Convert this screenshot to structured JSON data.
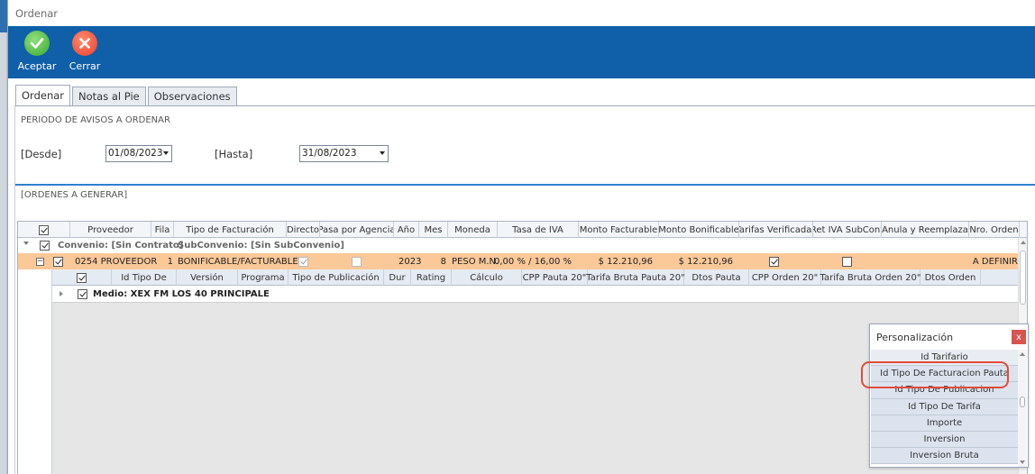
{
  "window": {
    "title": "Ordenar"
  },
  "toolbar": {
    "accept_label": "Aceptar",
    "close_label": "Cerrar"
  },
  "tabs": [
    "Ordenar",
    "Notas al Pie",
    "Observaciones"
  ],
  "periodo": {
    "section_title": "PERIODO DE AVISOS A ORDENAR",
    "desde_label": "[Desde]",
    "desde_value": "01/08/2023",
    "hasta_label": "[Hasta]",
    "hasta_value": "31/08/2023"
  },
  "ordenes": {
    "section_title": "[ORDENES A GENERAR]"
  },
  "grid": {
    "columns": [
      "Proveedor",
      "Fila",
      "Tipo de Facturación",
      "Directo",
      "Pasa por Agencia",
      "Año",
      "Mes",
      "Moneda",
      "Tasa de IVA",
      "Monto Facturable",
      "Monto Bonificable",
      "Tarifas Verificadas",
      "Ret IVA SubCont",
      "Anula y Reemplaza",
      "Nro. Orden"
    ],
    "group_row": {
      "convenio": "Convenio: [Sin Contrato]",
      "subconvenio": "SubConvenio: [Sin SubConvenio]"
    },
    "row": {
      "proveedor": "0254 PROVEEDOR",
      "fila": "1",
      "tipo_facturacion": "BONIFICABLE/FACTURABLE",
      "anio": "2023",
      "mes": "8",
      "moneda": "PESO M.N.",
      "tasa_iva": "0,00 % / 16,00 %",
      "monto_facturable": "$ 12.210,96",
      "monto_bonificable": "$ 12.210,96",
      "nro_orden": "A DEFINIR"
    },
    "sub_columns": [
      "Id Tipo De",
      "Versión",
      "Programa",
      "Tipo de Publicación",
      "Dur",
      "Rating",
      "Cálculo",
      "CPP Pauta 20\"",
      "Tarifa Bruta Pauta 20\"",
      "Dtos Pauta",
      "CPP Orden 20\"",
      "Tarifa Bruta Orden 20\"",
      "Dtos Orden"
    ],
    "medio_row": "Medio: XEX FM LOS 40 PRINCIPALE"
  },
  "personalizacion": {
    "title": "Personalización",
    "close_label": "x",
    "items": [
      "Id Tarifario",
      "Id Tipo De Facturacion Pauta",
      "Id Tipo De Publicacion",
      "Id Tipo De Tarifa",
      "Importe",
      "Inversion",
      "Inversion Bruta"
    ]
  },
  "colors": {
    "toolbar": "#0f5fa9",
    "row_highlight": "#fbc898",
    "accent_rule": "#2f7fcf",
    "callout": "#e14b3b"
  }
}
